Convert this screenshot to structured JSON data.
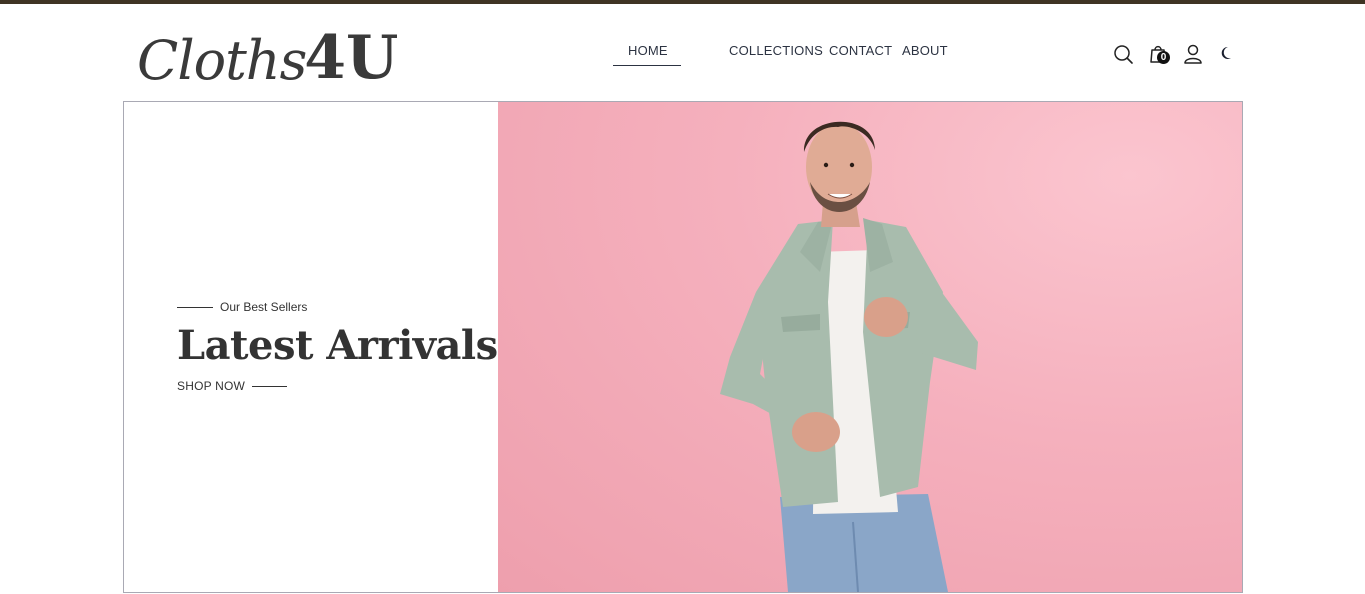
{
  "brand": {
    "logo_script": "Cloths",
    "logo_bold": "4U"
  },
  "nav": {
    "items": [
      {
        "label": "HOME",
        "active": true
      },
      {
        "label": "COLLECTIONS"
      },
      {
        "label": "CONTACT"
      },
      {
        "label": "ABOUT"
      }
    ]
  },
  "header_icons": {
    "search": "search-icon",
    "cart": "shopping-bag-icon",
    "cart_count": "0",
    "user": "user-icon",
    "theme": "moon-icon"
  },
  "hero": {
    "subtitle": "Our Best Sellers",
    "title": "Latest Arrivals",
    "cta_label": "SHOP NOW",
    "image_alt": "man in mint denim jacket on pink background"
  },
  "colors": {
    "top_strip": "#3f3424",
    "text": "#333333",
    "nav_text": "#2c3342",
    "hero_background": "#f5b0bd",
    "jacket": "#a8bcad",
    "jeans": "#8aa6c8"
  }
}
